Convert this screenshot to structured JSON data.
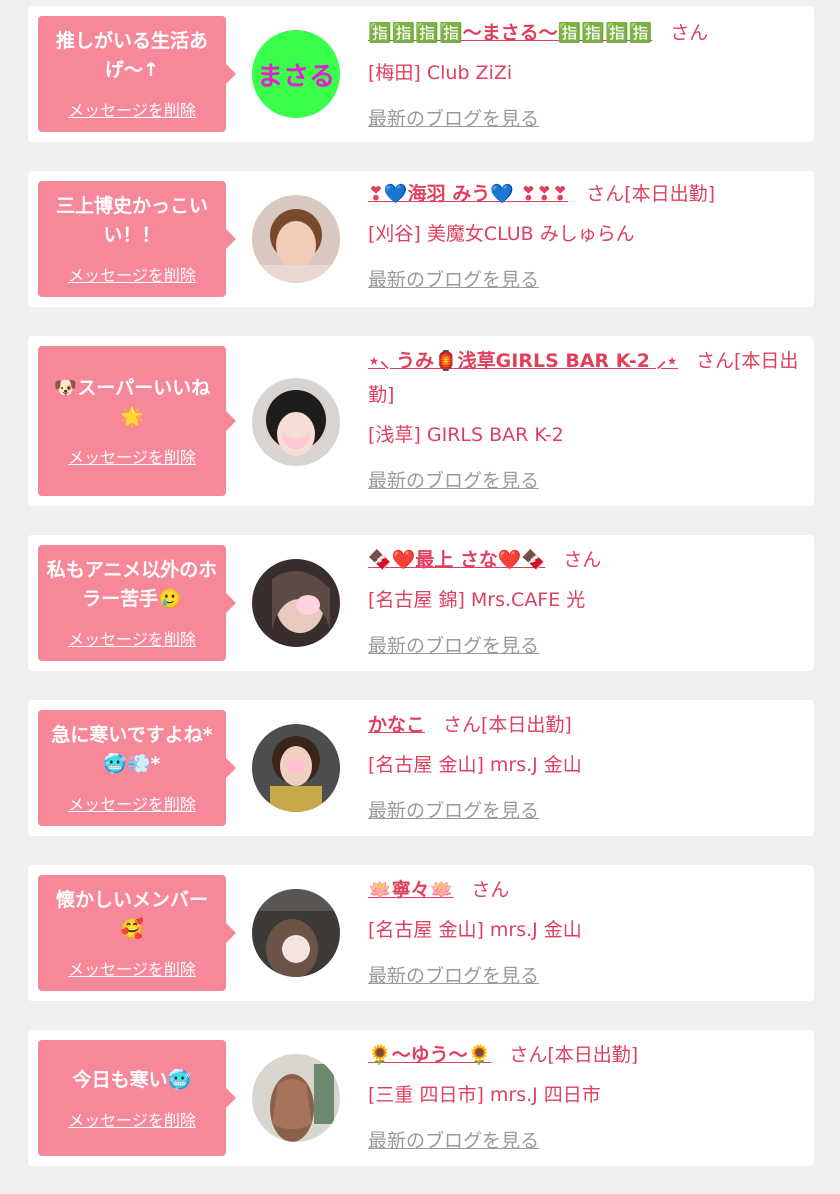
{
  "colors": {
    "bubble": "#f7889a",
    "accent": "#e0405e",
    "link_gray": "#9a9a9a",
    "background": "#efefef"
  },
  "messages": [
    {
      "message": "推しがいる生活あげ〜↑",
      "delete_label": "メッセージを削除",
      "name": "🈯🈯🈯🈯〜まさる〜🈯🈯🈯🈯",
      "suffix": "さん",
      "shop": "[梅田] Club ZiZi",
      "blog_label": "最新のブログを見る",
      "avatar_text": "まさる",
      "avatar_bg": "#39ff4a"
    },
    {
      "message": "三上博史かっこいい！！",
      "delete_label": "メッセージを削除",
      "name": "❣💙海羽 みう💙 ❣❣❣",
      "suffix": "さん[本日出勤]",
      "shop": "[刈谷] 美魔女CLUB みしゅらん",
      "blog_label": "最新のブログを見る",
      "avatar_bg": "#b48a78"
    },
    {
      "message": "🐶スーパーいいね🌟",
      "delete_label": "メッセージを削除",
      "name": "⋆⸜ うみ🏮浅草GIRLS BAR K-2 ⸝⋆",
      "suffix": "さん[本日出勤]",
      "shop": "[浅草] GIRLS BAR K-2",
      "blog_label": "最新のブログを見る",
      "avatar_bg": "#2e2a2a"
    },
    {
      "message": "私もアニメ以外のホラー苦手🥲",
      "delete_label": "メッセージを削除",
      "name": "🍫❤️最上 さな❤️🍫",
      "suffix": "さん",
      "shop": "[名古屋 錦] Mrs.CAFE 光",
      "blog_label": "最新のブログを見る",
      "avatar_bg": "#5a4640"
    },
    {
      "message": "急に寒いですよね*🥶💨*",
      "delete_label": "メッセージを削除",
      "name": "かなこ",
      "suffix": "さん[本日出勤]",
      "shop": "[名古屋 金山] mrs.J 金山",
      "blog_label": "最新のブログを見る",
      "avatar_bg": "#6b5a3c"
    },
    {
      "message": "懐かしいメンバー🥰",
      "delete_label": "メッセージを削除",
      "name": "🪷寧々🪷",
      "suffix": "さん",
      "shop": "[名古屋 金山] mrs.J 金山",
      "blog_label": "最新のブログを見る",
      "avatar_bg": "#4e4a48"
    },
    {
      "message": "今日も寒い🥶",
      "delete_label": "メッセージを削除",
      "name": "🌻〜ゆう〜🌻",
      "suffix": "さん[本日出勤]",
      "shop": "[三重 四日市] mrs.J 四日市",
      "blog_label": "最新のブログを見る",
      "avatar_bg": "#7a5e4e"
    }
  ]
}
